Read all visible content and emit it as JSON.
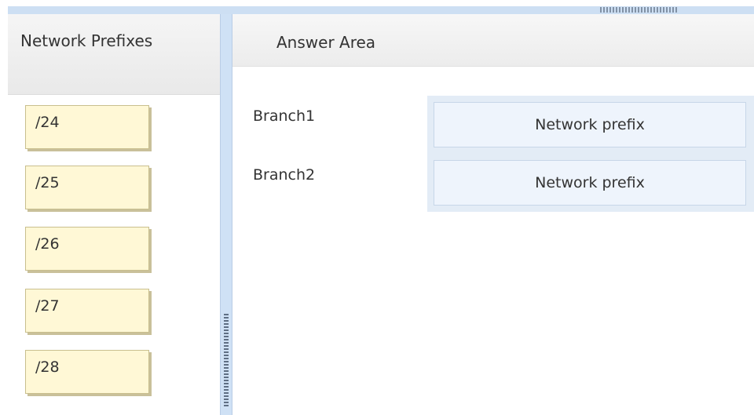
{
  "left_panel": {
    "title": "Network Prefixes",
    "prefixes": [
      "/24",
      "/25",
      "/26",
      "/27",
      "/28"
    ]
  },
  "answer_area": {
    "title": "Answer Area",
    "rows": [
      {
        "label": "Branch1",
        "target_placeholder": "Network prefix"
      },
      {
        "label": "Branch2",
        "target_placeholder": "Network prefix"
      }
    ]
  },
  "colors": {
    "tile_fill": "#fff8d6",
    "drop_zone": "#eef4fc",
    "divider": "#cfe1f5"
  }
}
